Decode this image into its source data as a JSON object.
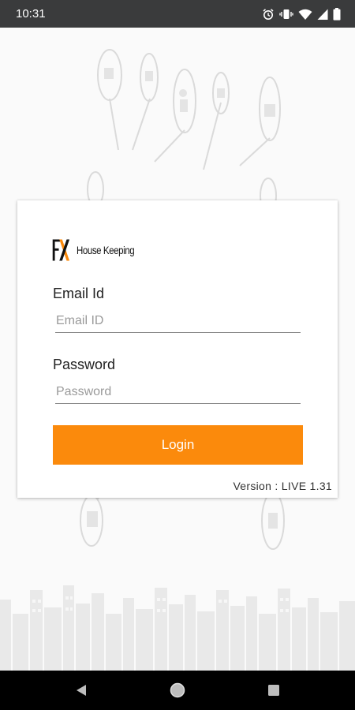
{
  "status_bar": {
    "time": "10:31",
    "icons": [
      "alarm-icon",
      "vibrate-icon",
      "wifi-icon",
      "signal-icon",
      "battery-icon"
    ]
  },
  "logo": {
    "mark": "FX",
    "text": "House Keeping"
  },
  "login_form": {
    "email_label": "Email Id",
    "email_placeholder": "Email ID",
    "email_value": "",
    "password_label": "Password",
    "password_placeholder": "Password",
    "password_value": "",
    "login_button_label": "Login"
  },
  "version": "Version : LIVE 1.31",
  "nav_bar": {
    "icons": [
      "back-icon",
      "home-icon",
      "recents-icon"
    ]
  },
  "colors": {
    "accent": "#fb8a0c",
    "status_bar": "#3a3b3c",
    "nav_bar": "#000000",
    "background": "#fafafa"
  }
}
